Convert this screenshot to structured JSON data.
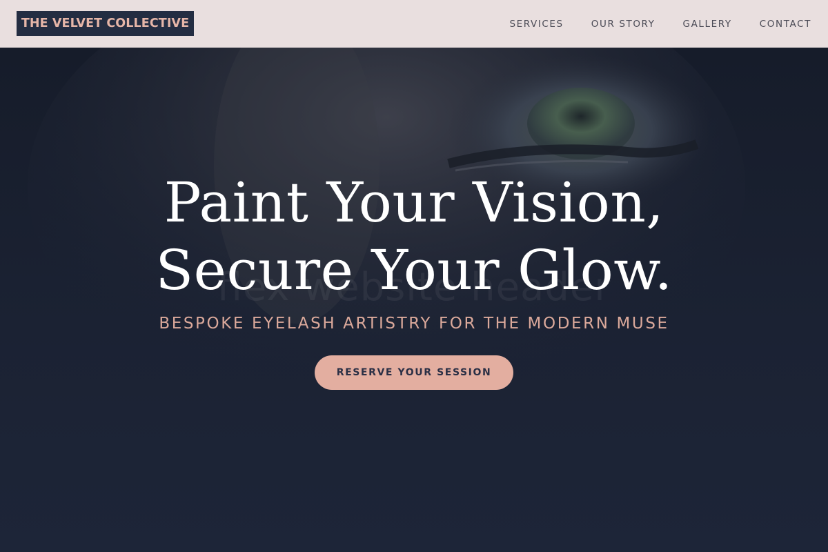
{
  "navbar": {
    "logo": "THE VELVET COLLECTIVE",
    "links": [
      "SERVICES",
      "OUR STORY",
      "GALLERY",
      "CONTACT"
    ]
  },
  "hero": {
    "headline_line1": "Paint Your Vision,",
    "headline_line2": "Secure Your Glow.",
    "tagline": "BESPOKE EYELASH ARTISTRY FOR THE MODERN MUSE",
    "cta": "RESERVE YOUR SESSION",
    "watermark_text": "flex website header"
  },
  "colors": {
    "nav_bg": "#e9dfdf",
    "logo_bg": "#232d42",
    "accent": "#e3aea0",
    "hero_bg": "#1b2233"
  }
}
